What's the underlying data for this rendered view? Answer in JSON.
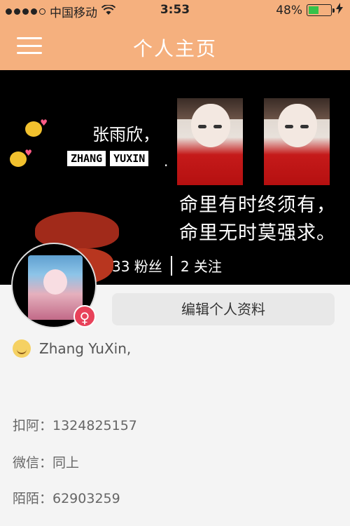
{
  "status_bar": {
    "carrier": "中国移动",
    "time": "3:53",
    "battery": "48%",
    "battery_level": 0.48
  },
  "nav": {
    "title": "个人主页"
  },
  "cover": {
    "name_cn": "张雨欣，",
    "name_en_1": "ZHANG",
    "name_en_2": "YUXIN",
    "dot": ".",
    "quote_line1": "命里有时终须有，",
    "quote_line2": "命里无时莫强求。"
  },
  "stats": {
    "followers": "33 粉丝",
    "following": "2 关注"
  },
  "profile": {
    "gender_symbol": "♀",
    "edit_label": "编辑个人资料",
    "bio": "Zhang YuXin,",
    "qq": "扣阿：1324825157",
    "wechat": "微信：同上",
    "momo": "陌陌：62903259"
  },
  "colors": {
    "accent": "#f5b07e",
    "gender": "#e8425a"
  }
}
